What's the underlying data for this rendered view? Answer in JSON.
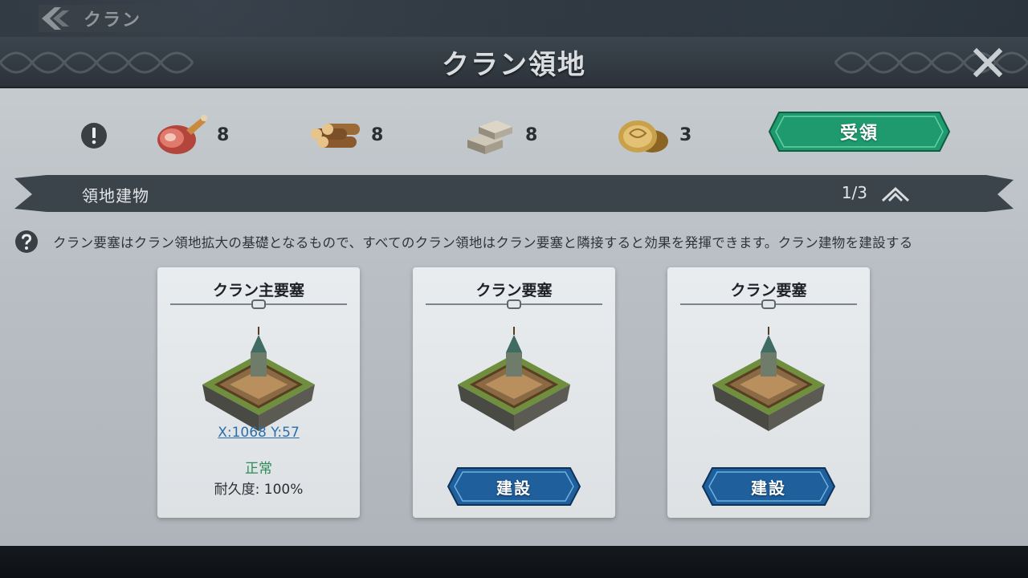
{
  "topbar": {
    "back_label": "クラン"
  },
  "window": {
    "title": "クラン領地"
  },
  "resources": [
    {
      "icon": "meat-icon",
      "count": "8"
    },
    {
      "icon": "wood-logs-icon",
      "count": "8"
    },
    {
      "icon": "stone-blocks-icon",
      "count": "8"
    },
    {
      "icon": "gold-coins-icon",
      "count": "3"
    }
  ],
  "claim_button": {
    "label": "受領"
  },
  "section": {
    "title": "領地建物",
    "count": "1/3"
  },
  "info": {
    "text": "クラン要塞はクラン領地拡大の基礎となるもので、すべてのクラン領地はクラン要塞と隣接すると効果を発揮できます。クラン建物を建設する"
  },
  "cards": [
    {
      "title": "クラン主要塞",
      "coords": "X:1068 Y:57",
      "status": "正常",
      "durability": "耐久度:  100%"
    },
    {
      "title": "クラン要塞",
      "button": "建設"
    },
    {
      "title": "クラン要塞",
      "button": "建設"
    }
  ],
  "colors": {
    "claim_green": "#1f9a6e",
    "build_blue": "#1e5f9c",
    "status_green": "#2c8b57",
    "coord_blue": "#2d6ea8"
  }
}
